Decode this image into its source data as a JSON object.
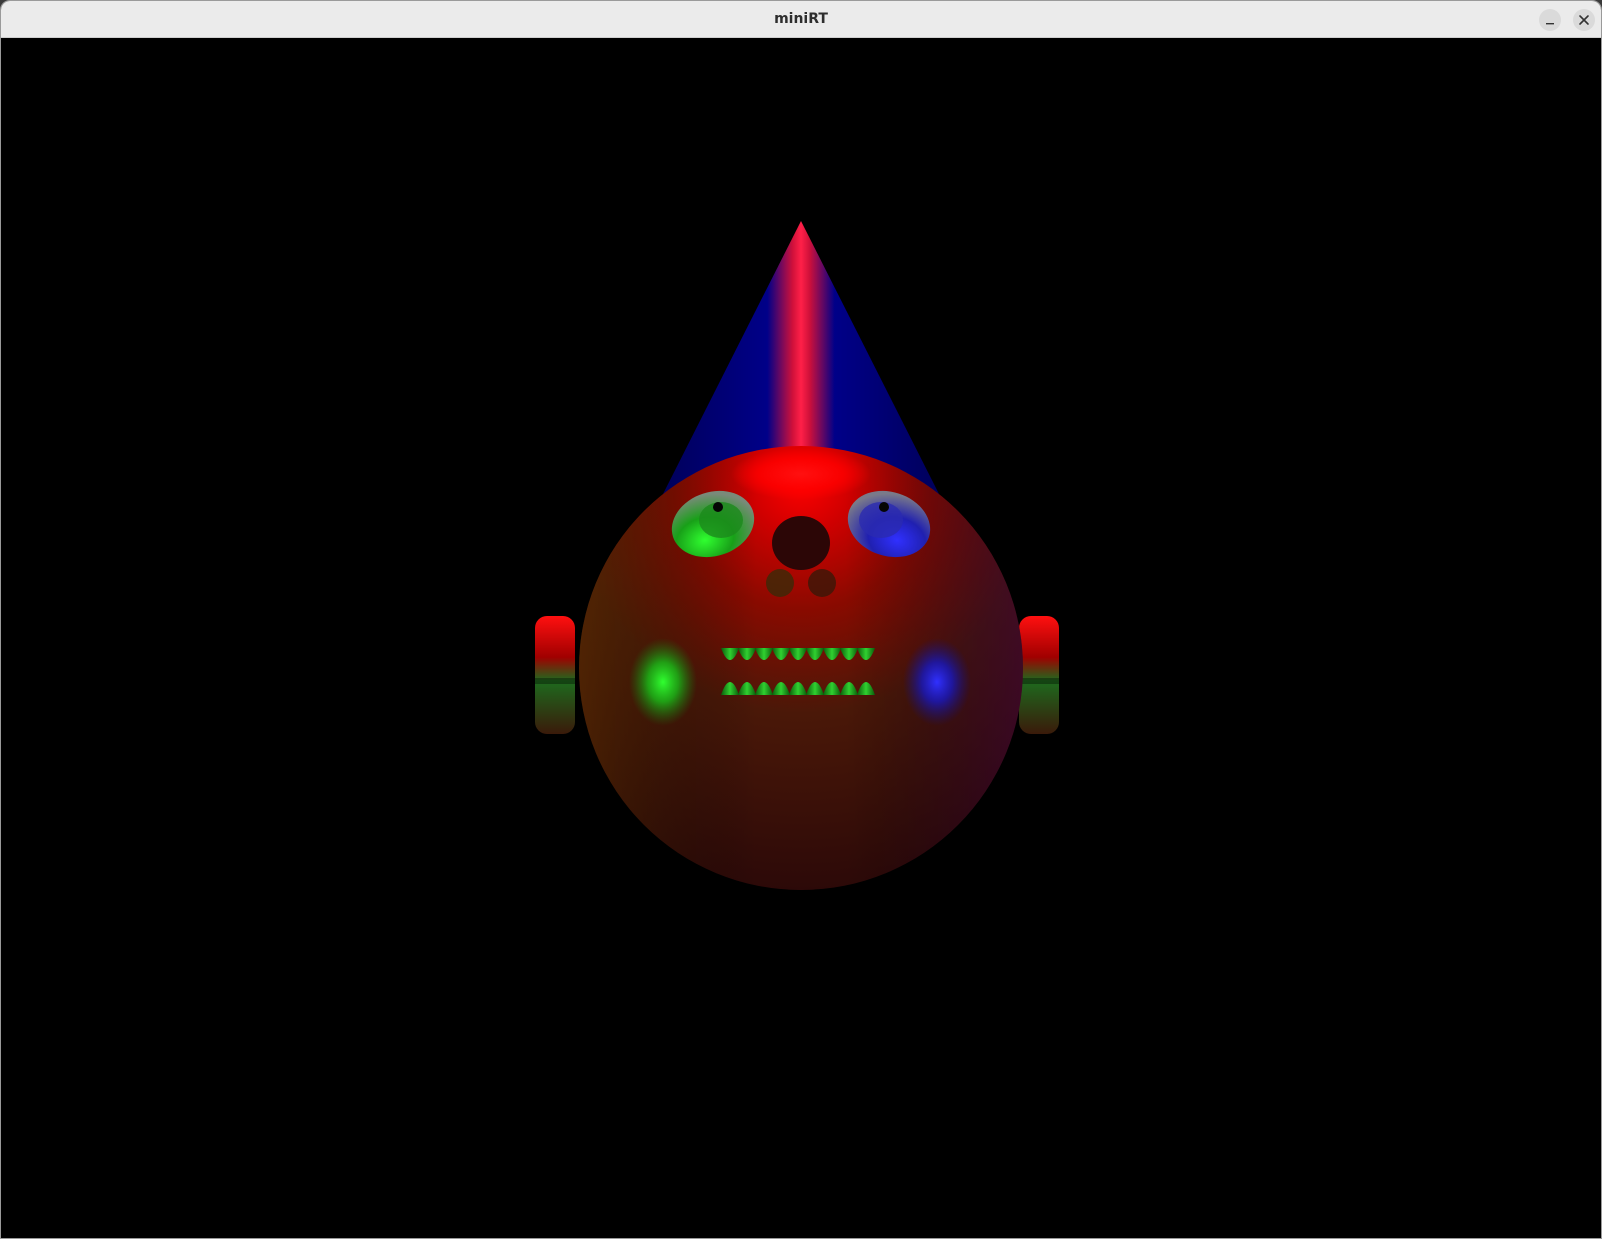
{
  "window": {
    "title": "miniRT",
    "controls": {
      "minimize_icon": "minimize-icon",
      "close_icon": "close-icon"
    }
  },
  "scene": {
    "background": "#000000",
    "colors": {
      "head": "#c00000",
      "hat": "#00007a",
      "hat_highlight": "#ff1a3a",
      "left_light": "#22ff22",
      "right_light": "#2a2aff",
      "eye_left": "#1ea01e",
      "eye_right": "#2a2ad0"
    }
  }
}
